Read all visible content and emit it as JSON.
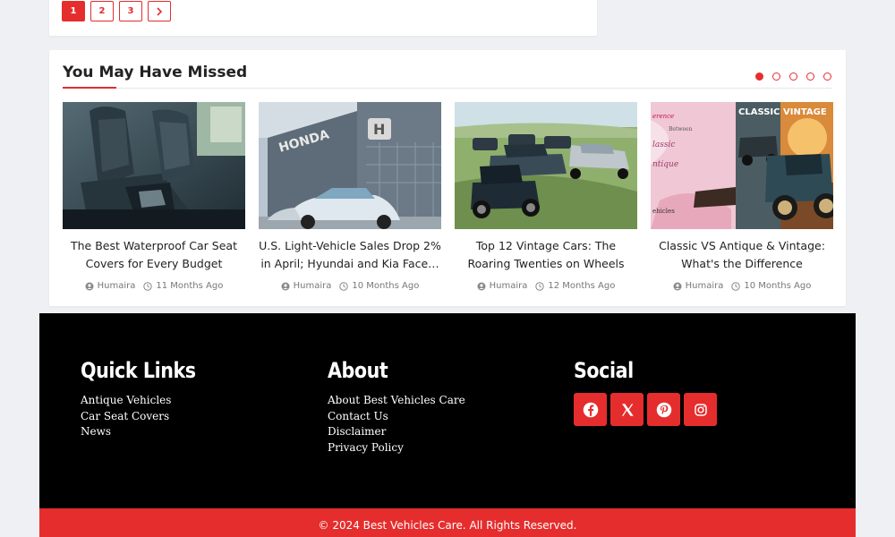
{
  "pagination": {
    "pages": [
      "1",
      "2",
      "3"
    ],
    "next_icon": "chevron-right-icon",
    "active_page": "1"
  },
  "missed": {
    "title": "You May Have Missed",
    "slider_dots": 5,
    "active_dot": 1,
    "cards": [
      {
        "title": "The Best Waterproof Car Seat Covers for Every Budget",
        "author": "Humaira",
        "date": "11 Months Ago",
        "image": "car-seat-cover-photo"
      },
      {
        "title": "U.S. Light-Vehicle Sales Drop 2% in April; Hyundai and Kia Face…",
        "author": "Humaira",
        "date": "10 Months Ago",
        "image": "honda-dealership-photo"
      },
      {
        "title": "Top 12 Vintage Cars: The Roaring Twenties on Wheels",
        "author": "Humaira",
        "date": "12 Months Ago",
        "image": "vintage-cars-field-photo"
      },
      {
        "title": "Classic VS Antique & Vintage: What's the Difference",
        "author": "Humaira",
        "date": "10 Months Ago",
        "image": "classic-vintage-antique-collage"
      }
    ]
  },
  "footer": {
    "quick_links": {
      "heading": "Quick Links",
      "items": [
        "Antique Vehicles",
        "Car Seat Covers",
        "News"
      ]
    },
    "about": {
      "heading": "About",
      "items": [
        "About Best Vehicles Care",
        "Contact Us",
        "Disclaimer",
        "Privacy Policy"
      ]
    },
    "social": {
      "heading": "Social",
      "icons": [
        "facebook-icon",
        "x-twitter-icon",
        "pinterest-icon",
        "instagram-icon"
      ]
    },
    "copyright": "© 2024 Best Vehicles Care. All Rights Reserved."
  },
  "thumb_text": {
    "honda_sign": "HONDA",
    "collage_heading": "CLASSIC",
    "collage_heading_2": "VINTAGE",
    "collage_lines": [
      "erence",
      "Between",
      "lassic",
      "ntique",
      "ehicles"
    ]
  },
  "colors": {
    "accent": "#e52d2d",
    "footer_bg": "#000000",
    "page_bg": "#eef0f3"
  }
}
